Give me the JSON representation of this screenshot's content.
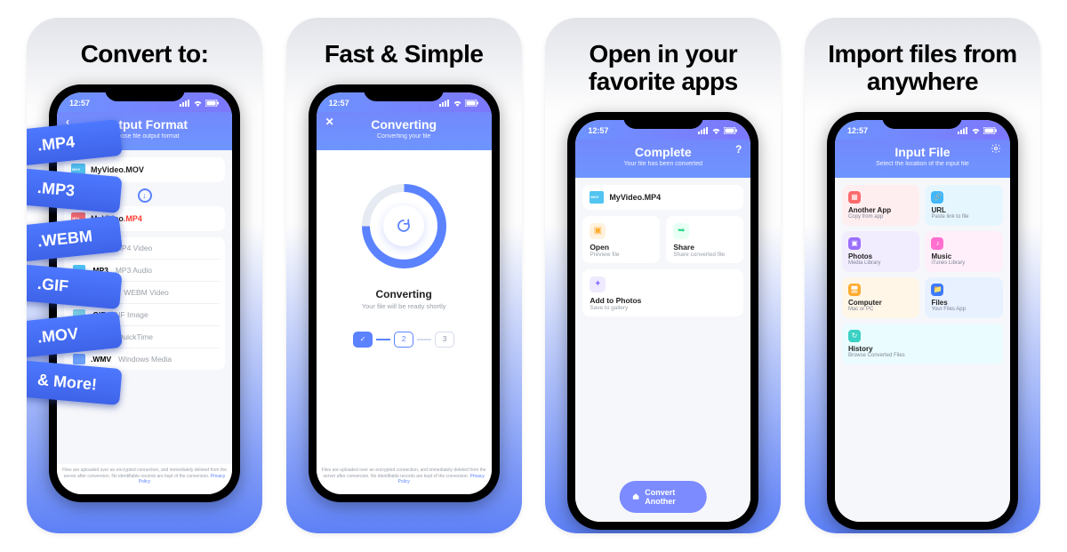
{
  "statusbar_time": "12:57",
  "panel1": {
    "title": "Convert to:",
    "chips": [
      ".MP4",
      ".MP3",
      ".WEBM",
      ".GIF",
      ".MOV",
      "& More!"
    ],
    "header_title": "Output Format",
    "header_sub": "Choose file output format",
    "file1": "MyVideo.MOV",
    "file2_base": "MyVideo",
    "file2_ext": ".MP4",
    "formats": [
      {
        "ext": ".MP4",
        "sub": "MP4 Video",
        "color": "#4fc3f7"
      },
      {
        "ext": ".MP3",
        "sub": "MP3 Audio",
        "color": "#4fc3f7"
      },
      {
        "ext": ".WEBM",
        "sub": "WEBM Video",
        "color": "#3ad1c4"
      },
      {
        "ext": ".GIF",
        "sub": "GIF Image",
        "color": "#7fd6e8"
      },
      {
        "ext": ".MOV",
        "sub": "QuickTime",
        "color": "#6ea4ff"
      },
      {
        "ext": ".WMV",
        "sub": "Windows Media",
        "color": "#6ea4ff"
      }
    ],
    "footer": "Files are uploaded over an encrypted connection, and immediately deleted from the server after conversion. No identifiable records are kept of the conversion.",
    "footer_link": "Privacy Policy"
  },
  "panel2": {
    "title": "Fast & Simple",
    "header_title": "Converting",
    "header_sub": "Converting your file",
    "mid_title": "Converting",
    "mid_sub": "Your file will be ready shortly",
    "steps": [
      "✓",
      "2",
      "3"
    ],
    "footer": "Files are uploaded over an encrypted connection, and immediately deleted from the server after conversion. No identifiable records are kept of the conversion.",
    "footer_link": "Privacy Policy"
  },
  "panel3": {
    "title": "Open in your favorite apps",
    "header_title": "Complete",
    "header_sub": "Your file has been converted",
    "file": "MyVideo.MP4",
    "actions": [
      {
        "t": "Open",
        "s": "Preview file",
        "bg": "#fff2df",
        "fg": "#ffab2e",
        "icon": "open"
      },
      {
        "t": "Share",
        "s": "Share converted file",
        "bg": "#e8fff3",
        "fg": "#2ed787",
        "icon": "share"
      },
      {
        "t": "Add to Photos",
        "s": "Save to gallery",
        "bg": "#efeaff",
        "fg": "#8f74ff",
        "icon": "photos",
        "full": true
      }
    ],
    "cta": "Convert Another"
  },
  "panel4": {
    "title": "Import files from anywhere",
    "header_title": "Input File",
    "header_sub": "Select the location of the input file",
    "tiles": [
      {
        "t": "Another App",
        "s": "Copy from app",
        "bg": "#ffeef0",
        "ic": "#ff6b6b"
      },
      {
        "t": "URL",
        "s": "Paste link to file",
        "bg": "#e6f6ff",
        "ic": "#3fb8ff"
      },
      {
        "t": "Photos",
        "s": "Media Library",
        "bg": "#f2ecff",
        "ic": "#9a6fff"
      },
      {
        "t": "Music",
        "s": "iTunes Library",
        "bg": "#ffeffa",
        "ic": "#ff6fcf"
      },
      {
        "t": "Computer",
        "s": "Mac or PC",
        "bg": "#fff6e8",
        "ic": "#ffab2e"
      },
      {
        "t": "Files",
        "s": "Your Files App",
        "bg": "#e8f1ff",
        "ic": "#3e7bff"
      },
      {
        "t": "History",
        "s": "Browse Converted Files",
        "bg": "#eafcff",
        "ic": "#3ad1c4",
        "full": true
      }
    ]
  }
}
